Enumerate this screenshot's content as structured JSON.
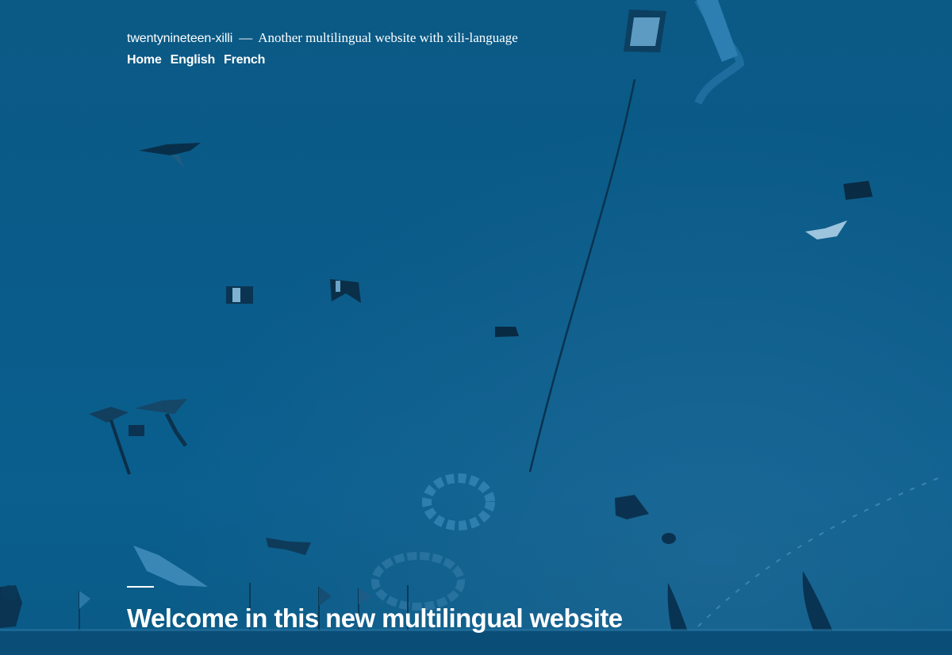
{
  "site": {
    "title": "twentynineteen-xilli",
    "separator": "—",
    "description": "Another multilingual website with xili-language"
  },
  "navigation": {
    "items": [
      {
        "label": "Home"
      },
      {
        "label": "English"
      },
      {
        "label": "French"
      }
    ]
  },
  "hero": {
    "image": "kites-over-beach-photo",
    "overlay_color": "#0a5c8a"
  },
  "post": {
    "title": "Welcome in this new multilingual website"
  }
}
